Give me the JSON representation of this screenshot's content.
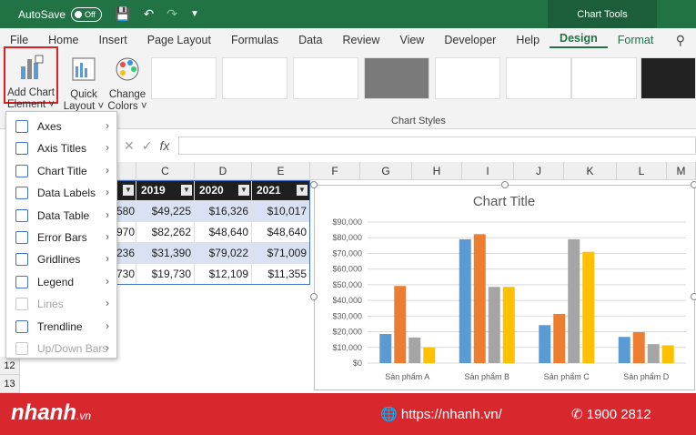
{
  "titlebar": {
    "autosave": "AutoSave",
    "toggle": "Off",
    "context": "Chart Tools"
  },
  "tabs": [
    "File",
    "Home",
    "Insert",
    "Page Layout",
    "Formulas",
    "Data",
    "Review",
    "View",
    "Developer",
    "Help",
    "Design",
    "Format"
  ],
  "ribbon": {
    "add_chart_element": "Add Chart\nElement",
    "quick_layout": "Quick\nLayout",
    "change_colors": "Change\nColors",
    "chart_styles": "Chart Styles"
  },
  "menu": [
    {
      "label": "Axes",
      "enabled": true
    },
    {
      "label": "Axis Titles",
      "enabled": true
    },
    {
      "label": "Chart Title",
      "enabled": true
    },
    {
      "label": "Data Labels",
      "enabled": true
    },
    {
      "label": "Data Table",
      "enabled": true
    },
    {
      "label": "Error Bars",
      "enabled": true
    },
    {
      "label": "Gridlines",
      "enabled": true
    },
    {
      "label": "Legend",
      "enabled": true
    },
    {
      "label": "Lines",
      "enabled": false
    },
    {
      "label": "Trendline",
      "enabled": true
    },
    {
      "label": "Up/Down Bars",
      "enabled": false
    }
  ],
  "columns": [
    "C",
    "D",
    "E",
    "F",
    "G",
    "H",
    "I",
    "J",
    "K",
    "L",
    "M"
  ],
  "rows": [
    "12",
    "13"
  ],
  "table": {
    "headers": [
      "2019",
      "2020",
      "2021"
    ],
    "partial_b": [
      "580",
      "970",
      "236",
      "730"
    ],
    "c": [
      "$49,225",
      "$82,262",
      "$31,390",
      "$19,730"
    ],
    "d": [
      "$16,326",
      "$48,640",
      "$79,022",
      "$12,109"
    ],
    "e": [
      "$10,017",
      "$48,640",
      "$71,009",
      "$11,355"
    ]
  },
  "chart_data": {
    "type": "bar",
    "title": "Chart Title",
    "categories": [
      "Sản phẩm A",
      "Sản phẩm B",
      "Sản phẩm C",
      "Sản phẩm D"
    ],
    "series": [
      {
        "color": "#5b9bd5",
        "values": [
          18580,
          78970,
          24236,
          16730
        ]
      },
      {
        "color": "#ed7d31",
        "values": [
          49225,
          82262,
          31390,
          19730
        ]
      },
      {
        "color": "#a5a5a5",
        "values": [
          16326,
          48640,
          79022,
          12109
        ]
      },
      {
        "color": "#ffc000",
        "values": [
          10017,
          48640,
          71009,
          11355
        ]
      }
    ],
    "yticks": [
      "$0",
      "$10,000",
      "$20,000",
      "$30,000",
      "$40,000",
      "$50,000",
      "$60,000",
      "$70,000",
      "$80,000",
      "$90,000"
    ],
    "ylim": [
      0,
      90000
    ],
    "grid": true
  },
  "footer": {
    "brand": "nhanh",
    "brand_suffix": ".vn",
    "website": "https://nhanh.vn/",
    "phone": "1900 2812"
  }
}
